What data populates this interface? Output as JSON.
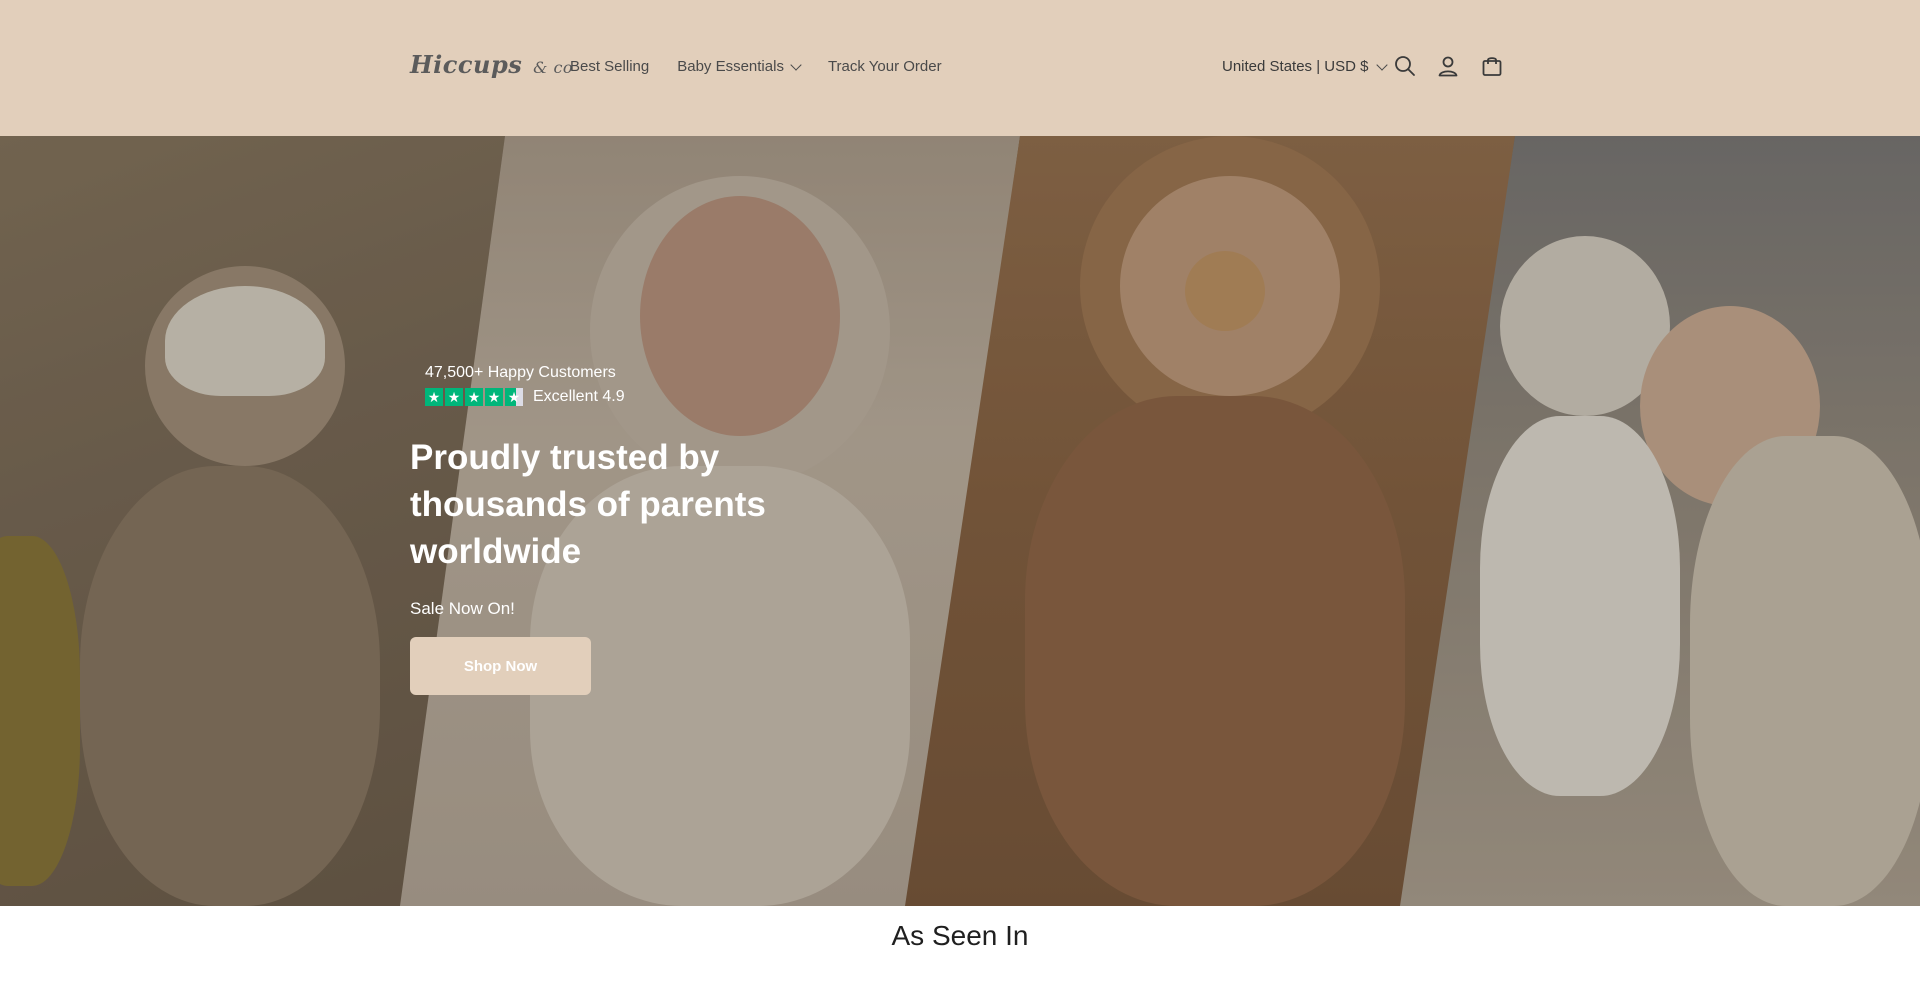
{
  "header": {
    "logo_main": "Hiccups",
    "logo_suffix": "& co",
    "nav": [
      {
        "label": "Best Selling"
      },
      {
        "label": "Baby Essentials"
      },
      {
        "label": "Track Your Order"
      }
    ],
    "locale": "United States | USD $",
    "icons": [
      "search-icon",
      "account-icon",
      "cart-icon"
    ]
  },
  "hero": {
    "customers": "47,500+ Happy Customers",
    "rating": "Excellent 4.9",
    "headline": "Proudly trusted by thousands of parents worldwide",
    "subtext": "Sale Now On!",
    "cta": "Shop Now",
    "star_rating": 4.6
  },
  "as_seen_in": "As Seen In",
  "colors": {
    "header_bg": "#e2cfbb",
    "button_bg": "#e2cfbb",
    "star_green": "#00b67a"
  }
}
